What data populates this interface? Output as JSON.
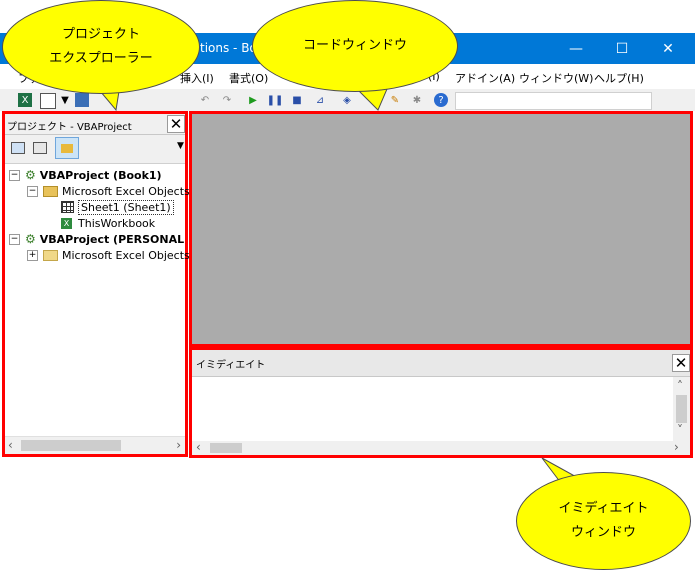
{
  "window": {
    "title": "tions - Bo",
    "minimize": "—",
    "maximize": "☐",
    "close": "✕"
  },
  "menu": {
    "items": [
      {
        "label": "ファ"
      },
      {
        "label": "挿入(I)"
      },
      {
        "label": "書式(O)"
      },
      {
        "label": "(I)"
      },
      {
        "label": "アドイン(A)"
      },
      {
        "label": "ウィンドウ(W)"
      },
      {
        "label": "ヘルプ(H)"
      }
    ]
  },
  "project_panel": {
    "title": "プロジェクト - VBAProject",
    "close": "✕",
    "tree": [
      {
        "label": "VBAProject (Book1)",
        "level": 0,
        "expander": "−",
        "bold": true
      },
      {
        "label": "Microsoft Excel Objects",
        "level": 1,
        "expander": "−",
        "bold": false
      },
      {
        "label": "Sheet1 (Sheet1)",
        "level": 2,
        "expander": "",
        "bold": false,
        "selected": true
      },
      {
        "label": "ThisWorkbook",
        "level": 2,
        "expander": "",
        "bold": false
      },
      {
        "label": "VBAProject (PERSONAL",
        "level": 0,
        "expander": "−",
        "bold": true
      },
      {
        "label": "Microsoft Excel Objects",
        "level": 1,
        "expander": "+",
        "bold": false
      }
    ]
  },
  "immediate": {
    "title": "イミディエイト",
    "close": "✕"
  },
  "callouts": {
    "project_line1": "プロジェクト",
    "project_line2": "エクスプローラー",
    "code": "コードウィンドウ",
    "immediate_line1": "イミディエイト",
    "immediate_line2": "ウィンドウ"
  },
  "colors": {
    "highlight_border": "#ff0000",
    "callout_fill": "#ffff00",
    "titlebar": "#0078d7",
    "code_bg": "#ababab"
  }
}
